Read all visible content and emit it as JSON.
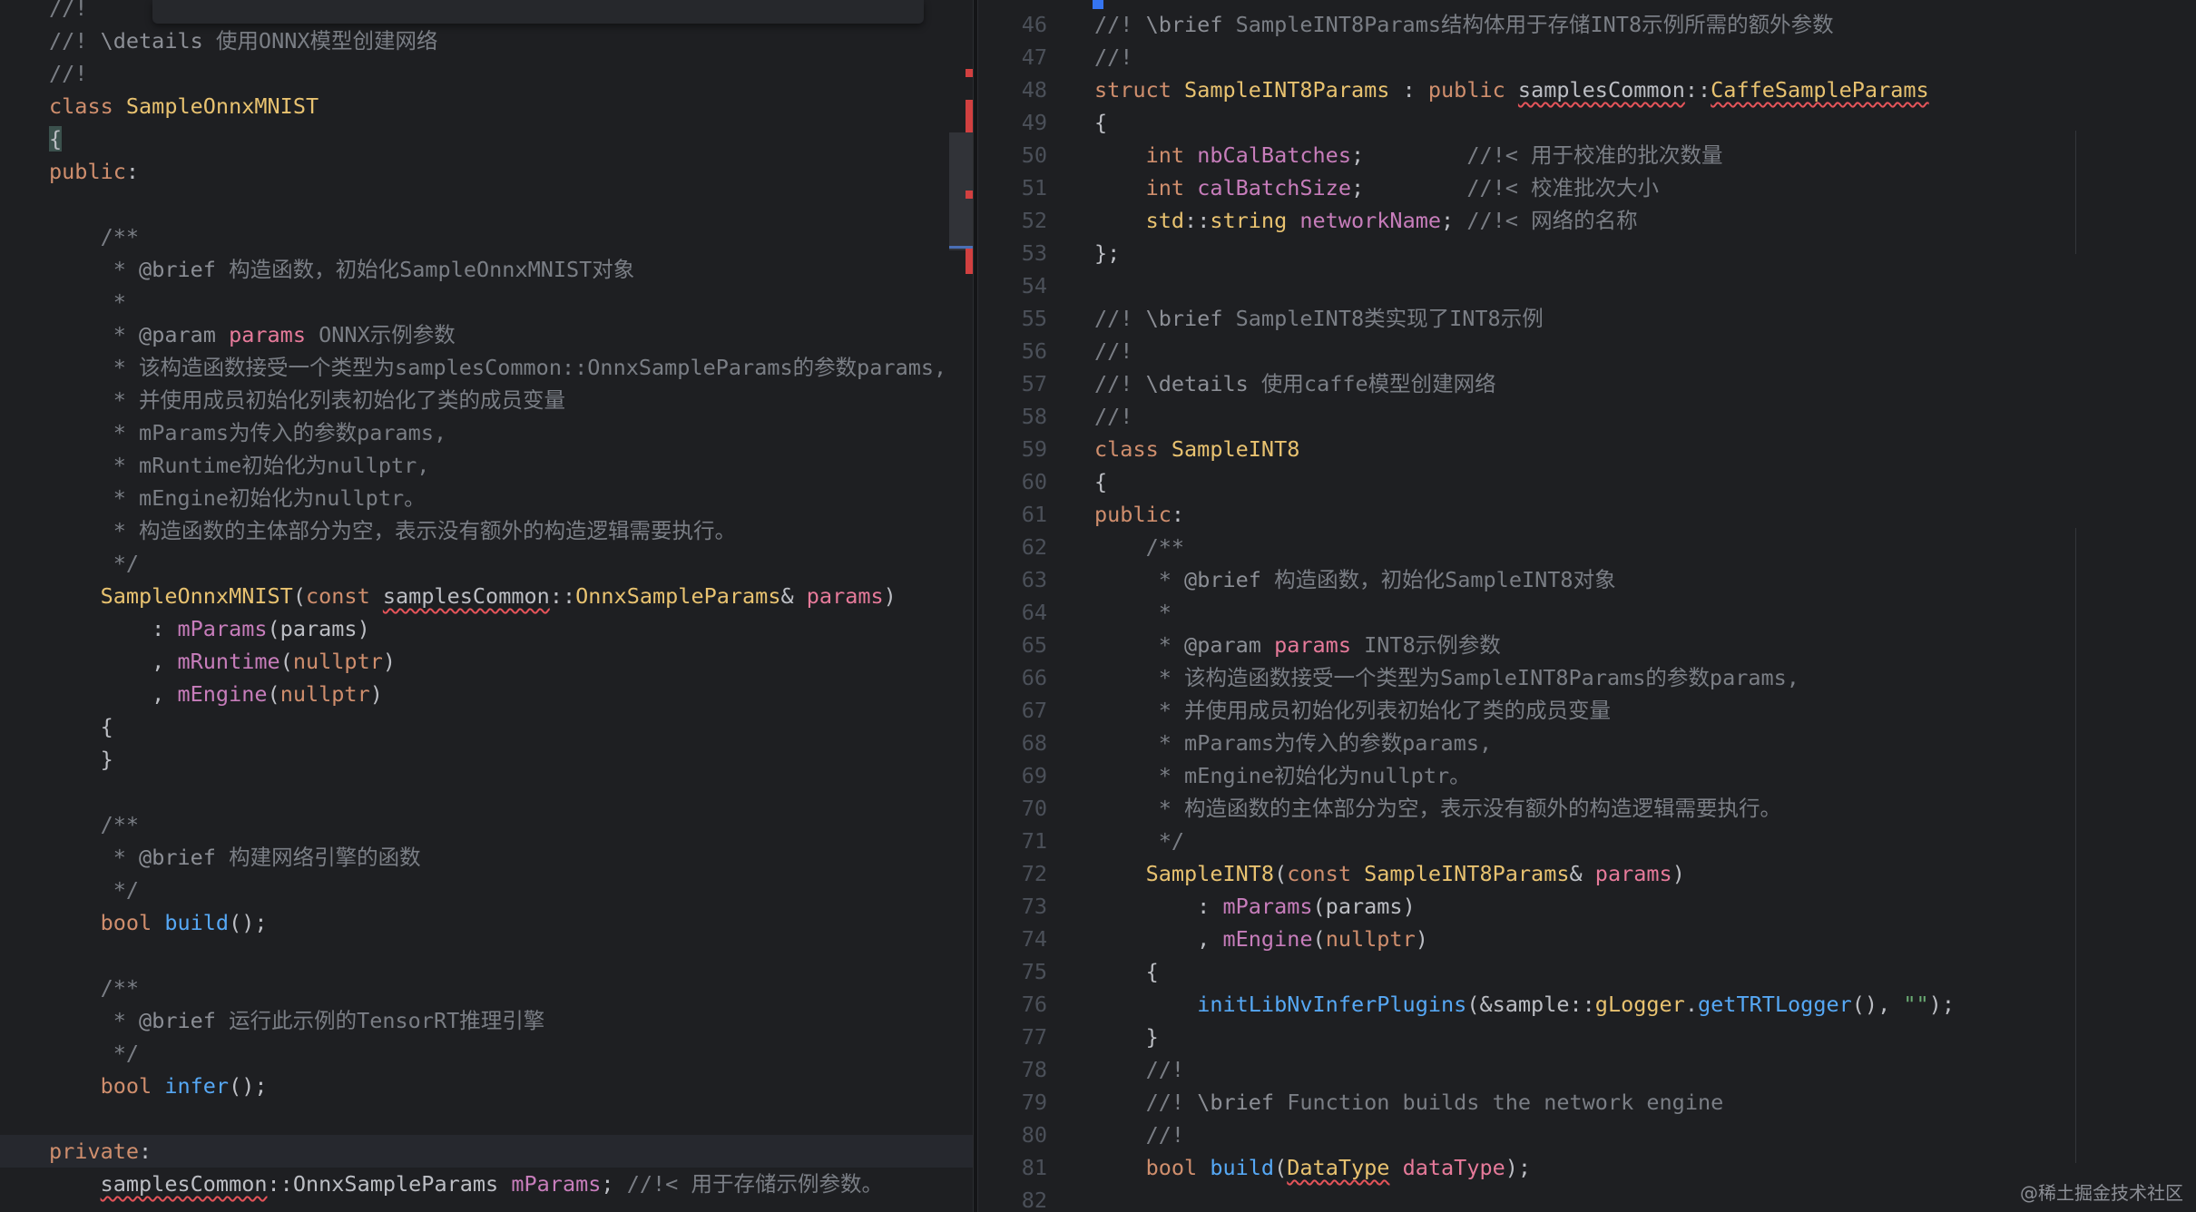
{
  "left_editor": {
    "lines": [
      {
        "tokens": [
          [
            "c",
            "//!"
          ]
        ]
      },
      {
        "tokens": [
          [
            "c",
            "//! "
          ],
          [
            "d",
            "\\details"
          ],
          [
            "c",
            " 使用ONNX模型创建网络"
          ]
        ]
      },
      {
        "tokens": [
          [
            "c",
            "//!"
          ]
        ]
      },
      {
        "tokens": [
          [
            "k",
            "class "
          ],
          [
            "t",
            "SampleOnnxMNIST"
          ]
        ]
      },
      {
        "tokens": [
          [
            "brace",
            "{"
          ]
        ]
      },
      {
        "tokens": [
          [
            "k",
            "public"
          ],
          [
            "pl",
            ":"
          ]
        ]
      },
      {
        "tokens": []
      },
      {
        "tokens": [
          [
            "pl",
            "    "
          ],
          [
            "c",
            "/**"
          ]
        ]
      },
      {
        "tokens": [
          [
            "pl",
            "     "
          ],
          [
            "c",
            "* "
          ],
          [
            "d",
            "@brief"
          ],
          [
            "c",
            " 构造函数，初始化SampleOnnxMNIST对象"
          ]
        ]
      },
      {
        "tokens": [
          [
            "pl",
            "     "
          ],
          [
            "c",
            "*"
          ]
        ]
      },
      {
        "tokens": [
          [
            "pl",
            "     "
          ],
          [
            "c",
            "* "
          ],
          [
            "d",
            "@param"
          ],
          [
            "p",
            " params"
          ],
          [
            "c",
            " ONNX示例参数"
          ]
        ]
      },
      {
        "tokens": [
          [
            "pl",
            "     "
          ],
          [
            "c",
            "* 该构造函数接受一个类型为samplesCommon::OnnxSampleParams的参数params,"
          ]
        ]
      },
      {
        "tokens": [
          [
            "pl",
            "     "
          ],
          [
            "c",
            "* 并使用成员初始化列表初始化了类的成员变量"
          ]
        ]
      },
      {
        "tokens": [
          [
            "pl",
            "     "
          ],
          [
            "c",
            "* mParams为传入的参数params,"
          ]
        ]
      },
      {
        "tokens": [
          [
            "pl",
            "     "
          ],
          [
            "c",
            "* mRuntime初始化为nullptr,"
          ]
        ]
      },
      {
        "tokens": [
          [
            "pl",
            "     "
          ],
          [
            "c",
            "* mEngine初始化为nullptr。"
          ]
        ]
      },
      {
        "tokens": [
          [
            "pl",
            "     "
          ],
          [
            "c",
            "* 构造函数的主体部分为空，表示没有额外的构造逻辑需要执行。"
          ]
        ]
      },
      {
        "tokens": [
          [
            "pl",
            "     "
          ],
          [
            "c",
            "*/"
          ]
        ]
      },
      {
        "tokens": [
          [
            "pl",
            "    "
          ],
          [
            "t",
            "SampleOnnxMNIST"
          ],
          [
            "pl",
            "("
          ],
          [
            "k",
            "const "
          ],
          [
            "u",
            "samplesCommon"
          ],
          [
            "pl",
            "::"
          ],
          [
            "t",
            "OnnxSampleParams"
          ],
          [
            "pl",
            "& "
          ],
          [
            "p",
            "params"
          ],
          [
            "pl",
            ")"
          ]
        ]
      },
      {
        "tokens": [
          [
            "pl",
            "        : "
          ],
          [
            "fm",
            "mParams"
          ],
          [
            "pl",
            "(params)"
          ]
        ]
      },
      {
        "tokens": [
          [
            "pl",
            "        , "
          ],
          [
            "fm",
            "mRuntime"
          ],
          [
            "pl",
            "("
          ],
          [
            "k",
            "nullptr"
          ],
          [
            "pl",
            ")"
          ]
        ]
      },
      {
        "tokens": [
          [
            "pl",
            "        , "
          ],
          [
            "fm",
            "mEngine"
          ],
          [
            "pl",
            "("
          ],
          [
            "k",
            "nullptr"
          ],
          [
            "pl",
            ")"
          ]
        ]
      },
      {
        "tokens": [
          [
            "pl",
            "    {"
          ]
        ]
      },
      {
        "tokens": [
          [
            "pl",
            "    }"
          ]
        ]
      },
      {
        "tokens": []
      },
      {
        "tokens": [
          [
            "pl",
            "    "
          ],
          [
            "c",
            "/**"
          ]
        ]
      },
      {
        "tokens": [
          [
            "pl",
            "     "
          ],
          [
            "c",
            "* "
          ],
          [
            "d",
            "@brief"
          ],
          [
            "c",
            " 构建网络引擎的函数"
          ]
        ]
      },
      {
        "tokens": [
          [
            "pl",
            "     "
          ],
          [
            "c",
            "*/"
          ]
        ]
      },
      {
        "tokens": [
          [
            "pl",
            "    "
          ],
          [
            "k",
            "bool "
          ],
          [
            "f",
            "build"
          ],
          [
            "pl",
            "();"
          ]
        ]
      },
      {
        "tokens": []
      },
      {
        "tokens": [
          [
            "pl",
            "    "
          ],
          [
            "c",
            "/**"
          ]
        ]
      },
      {
        "tokens": [
          [
            "pl",
            "     "
          ],
          [
            "c",
            "* "
          ],
          [
            "d",
            "@brief"
          ],
          [
            "c",
            " 运行此示例的TensorRT推理引擎"
          ]
        ]
      },
      {
        "tokens": [
          [
            "pl",
            "     "
          ],
          [
            "c",
            "*/"
          ]
        ]
      },
      {
        "tokens": [
          [
            "pl",
            "    "
          ],
          [
            "k",
            "bool "
          ],
          [
            "f",
            "infer"
          ],
          [
            "pl",
            "();"
          ]
        ]
      },
      {
        "tokens": []
      },
      {
        "tokens": [
          [
            "k",
            "private"
          ],
          [
            "pl",
            ":"
          ]
        ]
      },
      {
        "tokens": [
          [
            "pl",
            "    "
          ],
          [
            "u",
            "samplesCommon"
          ],
          [
            "pl",
            "::OnnxSampleParams "
          ],
          [
            "fm",
            "mParams"
          ],
          [
            "pl",
            "; "
          ],
          [
            "c",
            "//!< 用于存储示例参数。"
          ]
        ]
      }
    ]
  },
  "right_editor": {
    "lines": [
      {
        "n": "46",
        "tokens": [
          [
            "c",
            "//! "
          ],
          [
            "d",
            "\\brief"
          ],
          [
            "c",
            " SampleINT8Params结构体用于存储INT8示例所需的额外参数"
          ]
        ]
      },
      {
        "n": "47",
        "tokens": [
          [
            "c",
            "//!"
          ]
        ]
      },
      {
        "n": "48",
        "tokens": [
          [
            "k",
            "struct "
          ],
          [
            "t",
            "SampleINT8Params"
          ],
          [
            "pl",
            " : "
          ],
          [
            "k",
            "public "
          ],
          [
            "u",
            "samplesCommon"
          ],
          [
            "pl",
            "::"
          ],
          [
            "tu",
            "CaffeSampleParams"
          ]
        ]
      },
      {
        "n": "49",
        "tokens": [
          [
            "pl",
            "{"
          ]
        ]
      },
      {
        "n": "50",
        "tokens": [
          [
            "pl",
            "    "
          ],
          [
            "k",
            "int "
          ],
          [
            "fm",
            "nbCalBatches"
          ],
          [
            "pl",
            ";        "
          ],
          [
            "c",
            "//!< 用于校准的批次数量"
          ]
        ]
      },
      {
        "n": "51",
        "tokens": [
          [
            "pl",
            "    "
          ],
          [
            "k",
            "int "
          ],
          [
            "fm",
            "calBatchSize"
          ],
          [
            "pl",
            ";        "
          ],
          [
            "c",
            "//!< 校准批次大小"
          ]
        ]
      },
      {
        "n": "52",
        "tokens": [
          [
            "pl",
            "    "
          ],
          [
            "t",
            "std"
          ],
          [
            "pl",
            "::"
          ],
          [
            "t",
            "string "
          ],
          [
            "fm",
            "networkName"
          ],
          [
            "pl",
            "; "
          ],
          [
            "c",
            "//!< 网络的名称"
          ]
        ]
      },
      {
        "n": "53",
        "tokens": [
          [
            "pl",
            "};"
          ]
        ]
      },
      {
        "n": "54",
        "tokens": []
      },
      {
        "n": "55",
        "tokens": [
          [
            "c",
            "//! "
          ],
          [
            "d",
            "\\brief"
          ],
          [
            "c",
            " SampleINT8类实现了INT8示例"
          ]
        ]
      },
      {
        "n": "56",
        "tokens": [
          [
            "c",
            "//!"
          ]
        ]
      },
      {
        "n": "57",
        "tokens": [
          [
            "c",
            "//! "
          ],
          [
            "d",
            "\\details"
          ],
          [
            "c",
            " 使用caffe模型创建网络"
          ]
        ]
      },
      {
        "n": "58",
        "tokens": [
          [
            "c",
            "//!"
          ]
        ]
      },
      {
        "n": "59",
        "tokens": [
          [
            "k",
            "class "
          ],
          [
            "t",
            "SampleINT8"
          ]
        ]
      },
      {
        "n": "60",
        "tokens": [
          [
            "pl",
            "{"
          ]
        ]
      },
      {
        "n": "61",
        "tokens": [
          [
            "k",
            "public"
          ],
          [
            "pl",
            ":"
          ]
        ]
      },
      {
        "n": "62",
        "tokens": [
          [
            "pl",
            "    "
          ],
          [
            "c",
            "/**"
          ]
        ]
      },
      {
        "n": "63",
        "tokens": [
          [
            "pl",
            "     "
          ],
          [
            "c",
            "* "
          ],
          [
            "d",
            "@brief"
          ],
          [
            "c",
            " 构造函数，初始化SampleINT8对象"
          ]
        ]
      },
      {
        "n": "64",
        "tokens": [
          [
            "pl",
            "     "
          ],
          [
            "c",
            "*"
          ]
        ]
      },
      {
        "n": "65",
        "tokens": [
          [
            "pl",
            "     "
          ],
          [
            "c",
            "* "
          ],
          [
            "d",
            "@param"
          ],
          [
            "p",
            " params"
          ],
          [
            "c",
            " INT8示例参数"
          ]
        ]
      },
      {
        "n": "66",
        "tokens": [
          [
            "pl",
            "     "
          ],
          [
            "c",
            "* 该构造函数接受一个类型为SampleINT8Params的参数params,"
          ]
        ]
      },
      {
        "n": "67",
        "tokens": [
          [
            "pl",
            "     "
          ],
          [
            "c",
            "* 并使用成员初始化列表初始化了类的成员变量"
          ]
        ]
      },
      {
        "n": "68",
        "tokens": [
          [
            "pl",
            "     "
          ],
          [
            "c",
            "* mParams为传入的参数params,"
          ]
        ]
      },
      {
        "n": "69",
        "tokens": [
          [
            "pl",
            "     "
          ],
          [
            "c",
            "* mEngine初始化为nullptr。"
          ]
        ]
      },
      {
        "n": "70",
        "tokens": [
          [
            "pl",
            "     "
          ],
          [
            "c",
            "* 构造函数的主体部分为空，表示没有额外的构造逻辑需要执行。"
          ]
        ]
      },
      {
        "n": "71",
        "tokens": [
          [
            "pl",
            "     "
          ],
          [
            "c",
            "*/"
          ]
        ]
      },
      {
        "n": "72",
        "tokens": [
          [
            "pl",
            "    "
          ],
          [
            "t",
            "SampleINT8"
          ],
          [
            "pl",
            "("
          ],
          [
            "k",
            "const "
          ],
          [
            "t",
            "SampleINT8Params"
          ],
          [
            "pl",
            "& "
          ],
          [
            "p",
            "params"
          ],
          [
            "pl",
            ")"
          ]
        ]
      },
      {
        "n": "73",
        "tokens": [
          [
            "pl",
            "        : "
          ],
          [
            "fm",
            "mParams"
          ],
          [
            "pl",
            "(params)"
          ]
        ]
      },
      {
        "n": "74",
        "tokens": [
          [
            "pl",
            "        , "
          ],
          [
            "fm",
            "mEngine"
          ],
          [
            "pl",
            "("
          ],
          [
            "k",
            "nullptr"
          ],
          [
            "pl",
            ")"
          ]
        ]
      },
      {
        "n": "75",
        "tokens": [
          [
            "pl",
            "    {"
          ]
        ]
      },
      {
        "n": "76",
        "tokens": [
          [
            "pl",
            "        "
          ],
          [
            "f",
            "initLibNvInferPlugins"
          ],
          [
            "pl",
            "(&sample::"
          ],
          [
            "t",
            "gLogger"
          ],
          [
            "pl",
            "."
          ],
          [
            "f",
            "getTRTLogger"
          ],
          [
            "pl",
            "(), "
          ],
          [
            "s",
            "\"\""
          ],
          [
            "pl",
            ");"
          ]
        ]
      },
      {
        "n": "77",
        "tokens": [
          [
            "pl",
            "    }"
          ]
        ]
      },
      {
        "n": "78",
        "tokens": [
          [
            "pl",
            "    "
          ],
          [
            "c",
            "//!"
          ]
        ]
      },
      {
        "n": "79",
        "tokens": [
          [
            "pl",
            "    "
          ],
          [
            "c",
            "//! "
          ],
          [
            "d",
            "\\brief"
          ],
          [
            "c",
            " Function builds the network engine"
          ]
        ]
      },
      {
        "n": "80",
        "tokens": [
          [
            "pl",
            "    "
          ],
          [
            "c",
            "//!"
          ]
        ]
      },
      {
        "n": "81",
        "tokens": [
          [
            "pl",
            "    "
          ],
          [
            "k",
            "bool "
          ],
          [
            "f",
            "build"
          ],
          [
            "pl",
            "("
          ],
          [
            "tu",
            "DataType"
          ],
          [
            "p",
            " dataType"
          ],
          [
            "pl",
            ");"
          ]
        ]
      },
      {
        "n": "82",
        "tokens": []
      }
    ]
  },
  "watermark": "@稀土掘金技术社区",
  "colors": {
    "background": "#1e1f22",
    "keyword": "#cf8e6d",
    "comment": "#7a7e85",
    "doc_tag": "#67a37c",
    "type": "#e8c270",
    "function": "#56a8f5",
    "field": "#c77dbb",
    "parameter": "#e67a9a",
    "error_underline": "#e5545a"
  }
}
